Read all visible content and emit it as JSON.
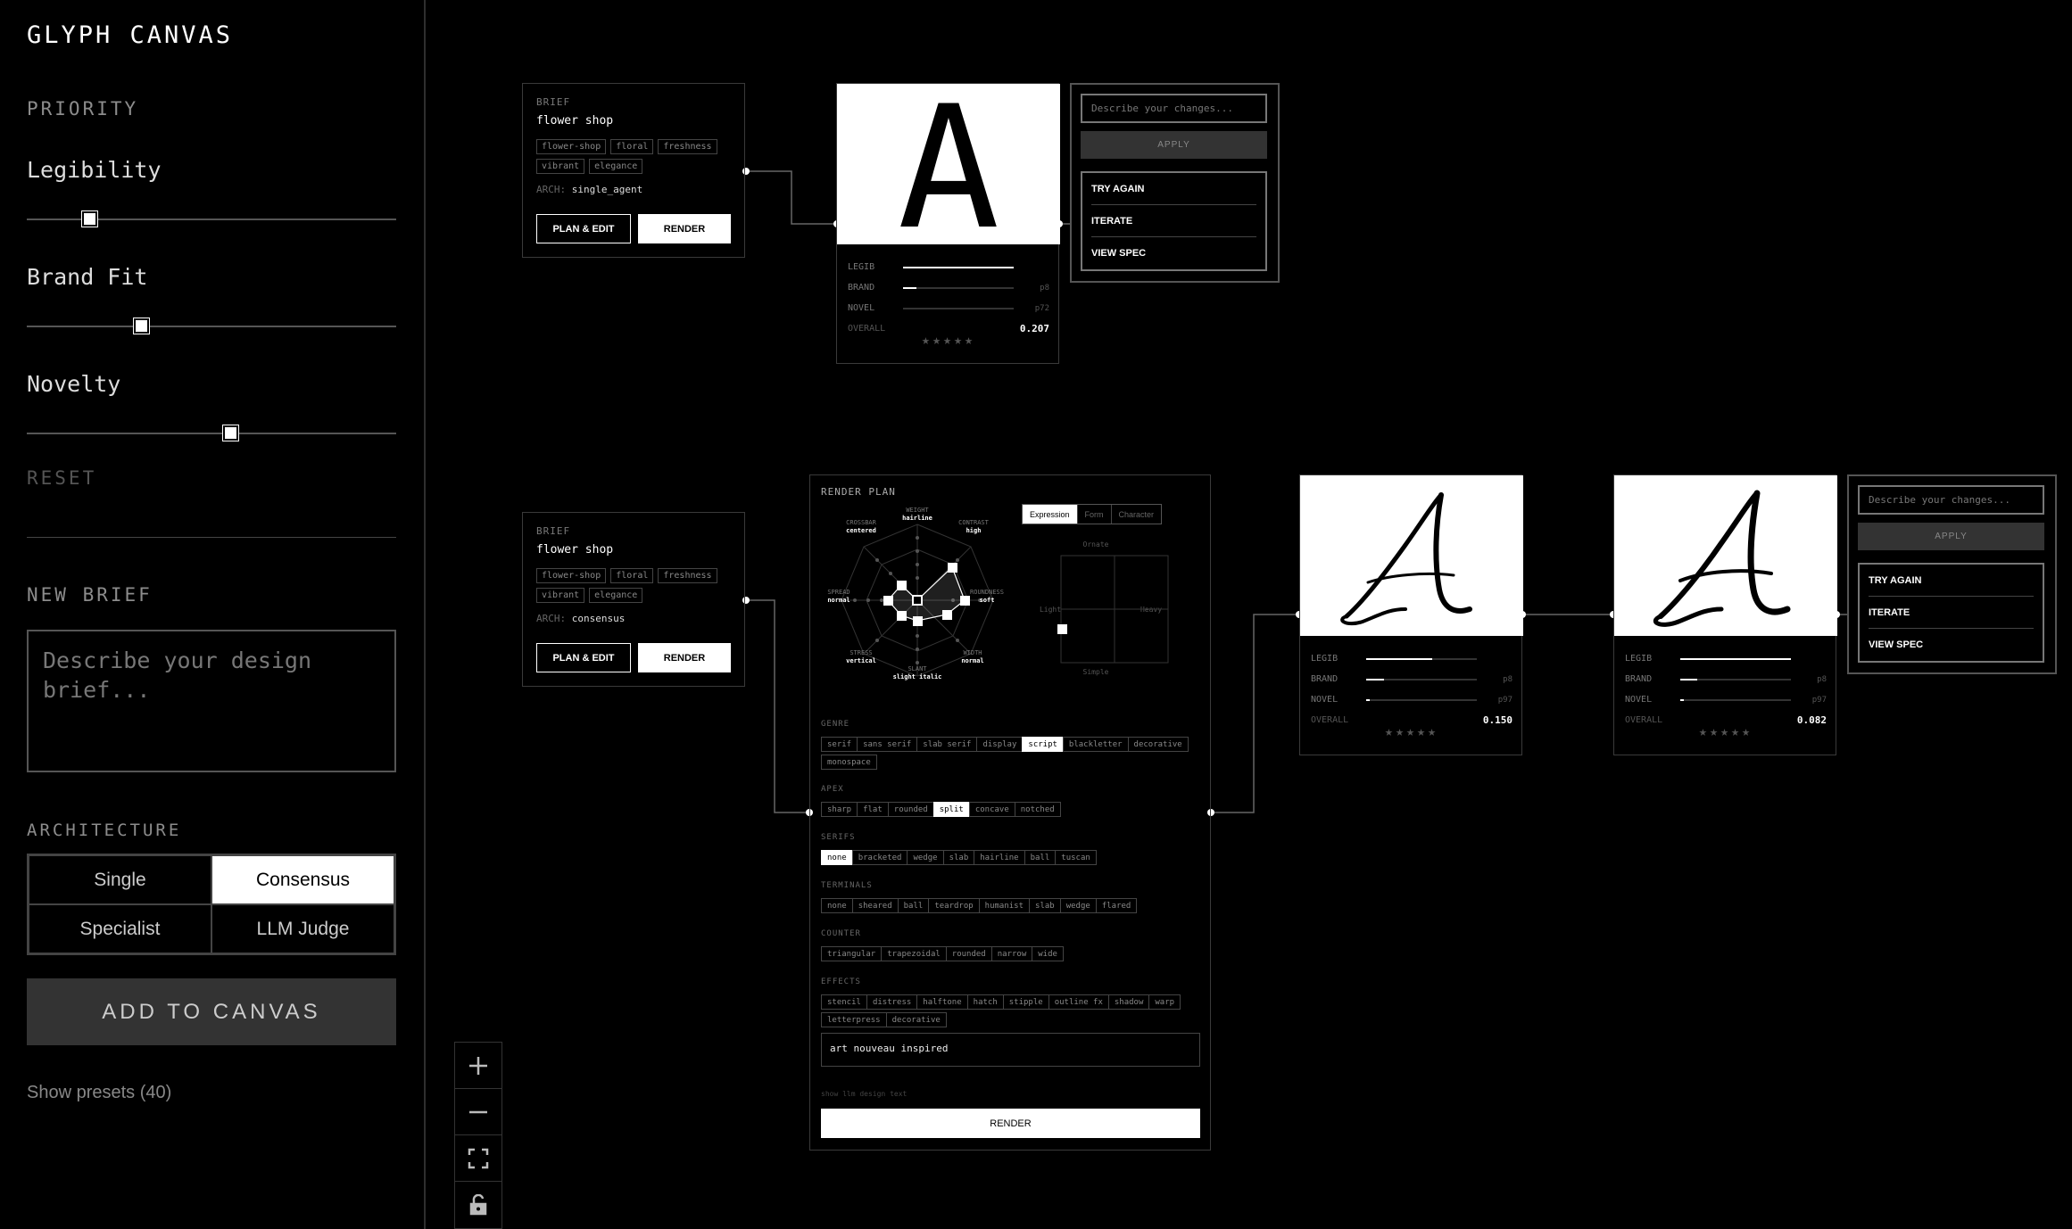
{
  "app": {
    "title": "GLYPH CANVAS"
  },
  "sidebar": {
    "priority_heading": "PRIORITY",
    "sliders": [
      {
        "label": "Legibility",
        "value": 0.17
      },
      {
        "label": "Brand Fit",
        "value": 0.31
      },
      {
        "label": "Novelty",
        "value": 0.55
      }
    ],
    "reset_label": "RESET",
    "new_brief_heading": "NEW BRIEF",
    "brief_placeholder": "Describe your design brief...",
    "architecture_heading": "ARCHITECTURE",
    "architectures": [
      "Single",
      "Consensus",
      "Specialist",
      "LLM Judge"
    ],
    "architecture_selected": "Consensus",
    "add_button": "ADD TO CANVAS",
    "presets_link": "Show presets (40)"
  },
  "zoom_controls": [
    "zoom-in-icon",
    "zoom-out-icon",
    "fit-screen-icon",
    "lock-icon"
  ],
  "briefs": [
    {
      "heading": "BRIEF",
      "text": "flower shop",
      "tags": [
        "flower-shop",
        "floral",
        "freshness",
        "vibrant",
        "elegance"
      ],
      "arch_label": "ARCH:",
      "arch_value": "single_agent",
      "plan_button": "PLAN & EDIT",
      "render_button": "RENDER"
    },
    {
      "heading": "BRIEF",
      "text": "flower shop",
      "tags": [
        "flower-shop",
        "floral",
        "freshness",
        "vibrant",
        "elegance"
      ],
      "arch_label": "ARCH:",
      "arch_value": "consensus",
      "plan_button": "PLAN & EDIT",
      "render_button": "RENDER"
    }
  ],
  "glyphs": [
    {
      "letter": "A",
      "metrics": [
        {
          "name": "LEGIB",
          "fill": 1.0,
          "value": ""
        },
        {
          "name": "BRAND",
          "fill": 0.12,
          "value": "p8"
        },
        {
          "name": "NOVEL",
          "fill": 0.0,
          "value": "p72"
        }
      ],
      "overall_label": "OVERALL",
      "overall": "0.207",
      "stars": "★★★★★"
    },
    {
      "letter": "A",
      "metrics": [
        {
          "name": "LEGIB",
          "fill": 0.6,
          "value": ""
        },
        {
          "name": "BRAND",
          "fill": 0.16,
          "value": "p8"
        },
        {
          "name": "NOVEL",
          "fill": 0.03,
          "value": "p97"
        }
      ],
      "overall_label": "OVERALL",
      "overall": "0.150",
      "stars": "★★★★★"
    },
    {
      "letter": "A",
      "metrics": [
        {
          "name": "LEGIB",
          "fill": 1.0,
          "value": ""
        },
        {
          "name": "BRAND",
          "fill": 0.15,
          "value": "p8"
        },
        {
          "name": "NOVEL",
          "fill": 0.03,
          "value": "p97"
        }
      ],
      "overall_label": "OVERALL",
      "overall": "0.082",
      "stars": "★★★★★"
    }
  ],
  "edit_panel": {
    "placeholder": "Describe your changes...",
    "apply": "APPLY",
    "menu": [
      "TRY AGAIN",
      "ITERATE",
      "VIEW SPEC"
    ]
  },
  "render_plan": {
    "title": "RENDER PLAN",
    "tabs": [
      "Expression",
      "Form",
      "Character"
    ],
    "active_tab": "Expression",
    "radar": [
      {
        "axis": "WEIGHT",
        "value": "hairline"
      },
      {
        "axis": "CONTRAST",
        "value": "high"
      },
      {
        "axis": "ROUNDNESS",
        "value": "soft"
      },
      {
        "axis": "WIDTH",
        "value": "normal"
      },
      {
        "axis": "SLANT",
        "value": "slight italic"
      },
      {
        "axis": "STRESS",
        "value": "vertical"
      },
      {
        "axis": "SPREAD",
        "value": "normal"
      },
      {
        "axis": "CROSSBAR",
        "value": "centered"
      }
    ],
    "quadrant": {
      "top": "Ornate",
      "bottom": "Simple",
      "left": "Light",
      "right": "Heavy"
    },
    "sections": [
      {
        "label": "GENRE",
        "options": [
          "serif",
          "sans serif",
          "slab serif",
          "display",
          "script",
          "blackletter",
          "decorative",
          "monospace"
        ],
        "selected": "script"
      },
      {
        "label": "APEX",
        "options": [
          "sharp",
          "flat",
          "rounded",
          "split",
          "concave",
          "notched"
        ],
        "selected": "split"
      },
      {
        "label": "SERIFS",
        "options": [
          "none",
          "bracketed",
          "wedge",
          "slab",
          "hairline",
          "ball",
          "tuscan"
        ],
        "selected": "none"
      },
      {
        "label": "TERMINALS",
        "options": [
          "none",
          "sheared",
          "ball",
          "teardrop",
          "humanist",
          "slab",
          "wedge",
          "flared"
        ],
        "selected": ""
      },
      {
        "label": "COUNTER",
        "options": [
          "triangular",
          "trapezoidal",
          "rounded",
          "narrow",
          "wide"
        ],
        "selected": ""
      },
      {
        "label": "EFFECTS",
        "options": [
          "stencil",
          "distress",
          "halftone",
          "hatch",
          "stipple",
          "outline fx",
          "shadow",
          "warp",
          "letterpress",
          "decorative"
        ],
        "selected": ""
      }
    ],
    "notes": "art nouveau inspired",
    "hint": "show llm design text",
    "render_button": "RENDER"
  }
}
